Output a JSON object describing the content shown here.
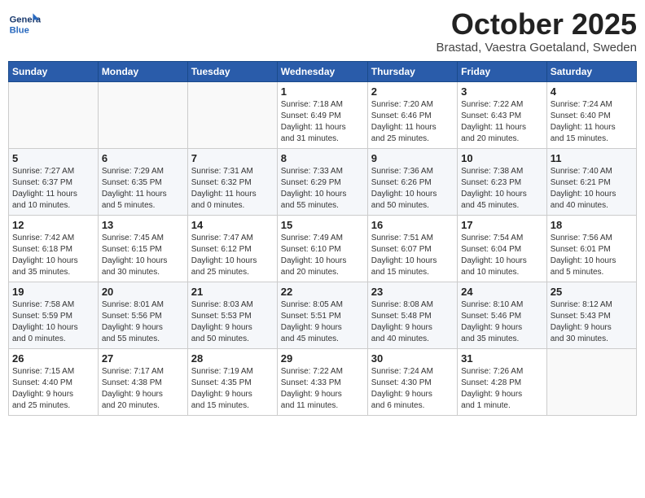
{
  "header": {
    "logo_text_general": "General",
    "logo_text_blue": "Blue",
    "month": "October 2025",
    "location": "Brastad, Vaestra Goetaland, Sweden"
  },
  "weekdays": [
    "Sunday",
    "Monday",
    "Tuesday",
    "Wednesday",
    "Thursday",
    "Friday",
    "Saturday"
  ],
  "weeks": [
    [
      {
        "day": "",
        "info": ""
      },
      {
        "day": "",
        "info": ""
      },
      {
        "day": "",
        "info": ""
      },
      {
        "day": "1",
        "info": "Sunrise: 7:18 AM\nSunset: 6:49 PM\nDaylight: 11 hours\nand 31 minutes."
      },
      {
        "day": "2",
        "info": "Sunrise: 7:20 AM\nSunset: 6:46 PM\nDaylight: 11 hours\nand 25 minutes."
      },
      {
        "day": "3",
        "info": "Sunrise: 7:22 AM\nSunset: 6:43 PM\nDaylight: 11 hours\nand 20 minutes."
      },
      {
        "day": "4",
        "info": "Sunrise: 7:24 AM\nSunset: 6:40 PM\nDaylight: 11 hours\nand 15 minutes."
      }
    ],
    [
      {
        "day": "5",
        "info": "Sunrise: 7:27 AM\nSunset: 6:37 PM\nDaylight: 11 hours\nand 10 minutes."
      },
      {
        "day": "6",
        "info": "Sunrise: 7:29 AM\nSunset: 6:35 PM\nDaylight: 11 hours\nand 5 minutes."
      },
      {
        "day": "7",
        "info": "Sunrise: 7:31 AM\nSunset: 6:32 PM\nDaylight: 11 hours\nand 0 minutes."
      },
      {
        "day": "8",
        "info": "Sunrise: 7:33 AM\nSunset: 6:29 PM\nDaylight: 10 hours\nand 55 minutes."
      },
      {
        "day": "9",
        "info": "Sunrise: 7:36 AM\nSunset: 6:26 PM\nDaylight: 10 hours\nand 50 minutes."
      },
      {
        "day": "10",
        "info": "Sunrise: 7:38 AM\nSunset: 6:23 PM\nDaylight: 10 hours\nand 45 minutes."
      },
      {
        "day": "11",
        "info": "Sunrise: 7:40 AM\nSunset: 6:21 PM\nDaylight: 10 hours\nand 40 minutes."
      }
    ],
    [
      {
        "day": "12",
        "info": "Sunrise: 7:42 AM\nSunset: 6:18 PM\nDaylight: 10 hours\nand 35 minutes."
      },
      {
        "day": "13",
        "info": "Sunrise: 7:45 AM\nSunset: 6:15 PM\nDaylight: 10 hours\nand 30 minutes."
      },
      {
        "day": "14",
        "info": "Sunrise: 7:47 AM\nSunset: 6:12 PM\nDaylight: 10 hours\nand 25 minutes."
      },
      {
        "day": "15",
        "info": "Sunrise: 7:49 AM\nSunset: 6:10 PM\nDaylight: 10 hours\nand 20 minutes."
      },
      {
        "day": "16",
        "info": "Sunrise: 7:51 AM\nSunset: 6:07 PM\nDaylight: 10 hours\nand 15 minutes."
      },
      {
        "day": "17",
        "info": "Sunrise: 7:54 AM\nSunset: 6:04 PM\nDaylight: 10 hours\nand 10 minutes."
      },
      {
        "day": "18",
        "info": "Sunrise: 7:56 AM\nSunset: 6:01 PM\nDaylight: 10 hours\nand 5 minutes."
      }
    ],
    [
      {
        "day": "19",
        "info": "Sunrise: 7:58 AM\nSunset: 5:59 PM\nDaylight: 10 hours\nand 0 minutes."
      },
      {
        "day": "20",
        "info": "Sunrise: 8:01 AM\nSunset: 5:56 PM\nDaylight: 9 hours\nand 55 minutes."
      },
      {
        "day": "21",
        "info": "Sunrise: 8:03 AM\nSunset: 5:53 PM\nDaylight: 9 hours\nand 50 minutes."
      },
      {
        "day": "22",
        "info": "Sunrise: 8:05 AM\nSunset: 5:51 PM\nDaylight: 9 hours\nand 45 minutes."
      },
      {
        "day": "23",
        "info": "Sunrise: 8:08 AM\nSunset: 5:48 PM\nDaylight: 9 hours\nand 40 minutes."
      },
      {
        "day": "24",
        "info": "Sunrise: 8:10 AM\nSunset: 5:46 PM\nDaylight: 9 hours\nand 35 minutes."
      },
      {
        "day": "25",
        "info": "Sunrise: 8:12 AM\nSunset: 5:43 PM\nDaylight: 9 hours\nand 30 minutes."
      }
    ],
    [
      {
        "day": "26",
        "info": "Sunrise: 7:15 AM\nSunset: 4:40 PM\nDaylight: 9 hours\nand 25 minutes."
      },
      {
        "day": "27",
        "info": "Sunrise: 7:17 AM\nSunset: 4:38 PM\nDaylight: 9 hours\nand 20 minutes."
      },
      {
        "day": "28",
        "info": "Sunrise: 7:19 AM\nSunset: 4:35 PM\nDaylight: 9 hours\nand 15 minutes."
      },
      {
        "day": "29",
        "info": "Sunrise: 7:22 AM\nSunset: 4:33 PM\nDaylight: 9 hours\nand 11 minutes."
      },
      {
        "day": "30",
        "info": "Sunrise: 7:24 AM\nSunset: 4:30 PM\nDaylight: 9 hours\nand 6 minutes."
      },
      {
        "day": "31",
        "info": "Sunrise: 7:26 AM\nSunset: 4:28 PM\nDaylight: 9 hours\nand 1 minute."
      },
      {
        "day": "",
        "info": ""
      }
    ]
  ]
}
